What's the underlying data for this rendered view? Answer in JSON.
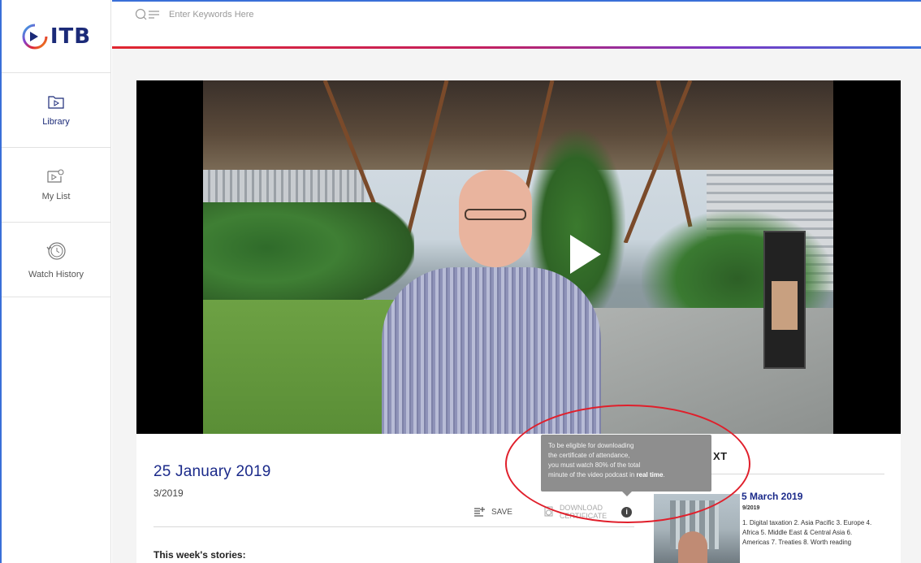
{
  "brand": {
    "logo_text": "ITB",
    "accent": "#1b2a78"
  },
  "search": {
    "placeholder": "Enter Keywords Here"
  },
  "sidebar": {
    "items": [
      {
        "label": "Library",
        "icon": "folder-play-icon"
      },
      {
        "label": "My List",
        "icon": "playlist-icon"
      },
      {
        "label": "Watch History",
        "icon": "history-icon"
      }
    ]
  },
  "video": {
    "title": "25 January 2019",
    "issue": "3/2019",
    "play_icon": "play-icon"
  },
  "actions": {
    "save_label": "SAVE",
    "download_label_line1": "DOWNLOAD",
    "download_label_line2": "CERTIFICATE",
    "info_glyph": "i"
  },
  "tooltip": {
    "line1": "To be eligible for downloading",
    "line2": "the certificate of attendance,",
    "line3": "you must watch 80% of the total",
    "line4_prefix": "minute of the video podcast in ",
    "line4_bold": "real time",
    "line4_suffix": "."
  },
  "content": {
    "stories_heading": "This week's stories:"
  },
  "upnext": {
    "title": "XT",
    "date": "5 March 2019",
    "issue": "9/2019",
    "description": "1. Digital taxation 2. Asia Pacific 3. Europe 4. Africa 5. Middle East & Central Asia 6. Americas 7. Treaties 8. Worth reading"
  },
  "colors": {
    "title_blue": "#1b2a8a",
    "annotation_red": "#e01f2b",
    "topline_start": "#e0262f",
    "topline_end": "#3a6fd8"
  }
}
